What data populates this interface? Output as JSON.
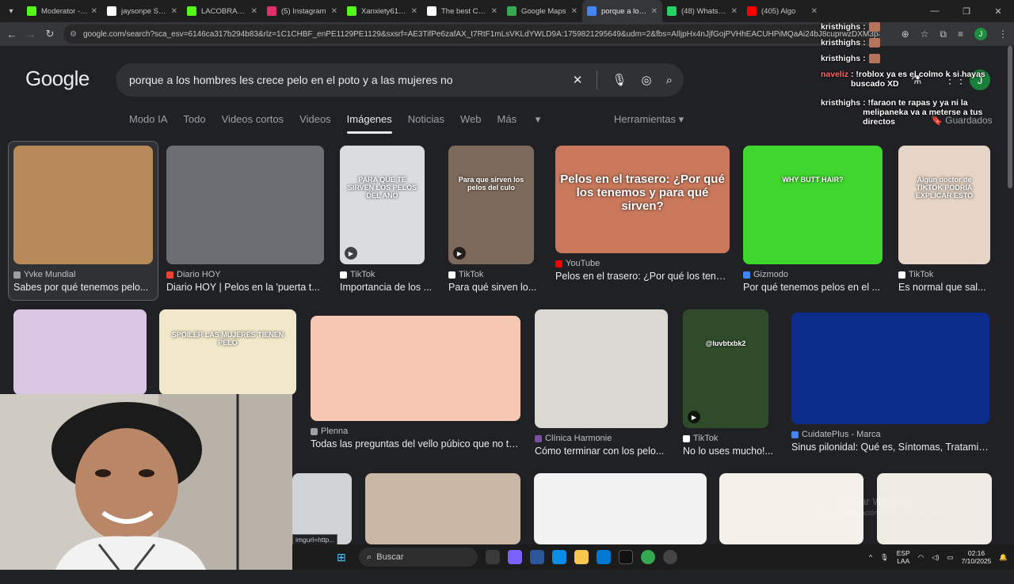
{
  "tabs": [
    {
      "label": "Moderator - Ki",
      "color": "#53fc18"
    },
    {
      "label": "jaysonpe Shop",
      "color": "#ffffff"
    },
    {
      "label": "LACOBRAAA St",
      "color": "#53fc18"
    },
    {
      "label": "(5) Instagram",
      "color": "#e1306c"
    },
    {
      "label": "Xanxiety616 St",
      "color": "#53fc18"
    },
    {
      "label": "The best Chatl",
      "color": "#ffffff"
    },
    {
      "label": "Google Maps",
      "color": "#34a853"
    },
    {
      "label": "porque a los h",
      "color": "#4285f4",
      "active": true
    },
    {
      "label": "(48) WhatsApp",
      "color": "#25d366"
    },
    {
      "label": "(405) Algo",
      "color": "#ff0000"
    }
  ],
  "address": {
    "url": "google.com/search?sca_esv=6146ca317b294b83&rlz=1C1CHBF_enPE1129PE1129&sxsrf=AE3TifPe6zafAX_t7RtF1mLsVKLdYWLD9A:1759821295649&udm=2&fbs=AIljpHx4nJjfGojPVHhEACUHPiMQaAi24bJ8cuprwzDXM3paF1drghZS4WZkW..."
  },
  "search": {
    "logo": "Google",
    "query": "porque a los hombres les crece pelo en el poto y a las mujeres no"
  },
  "nav": {
    "tabs": [
      "Modo IA",
      "Todo",
      "Videos cortos",
      "Videos",
      "Imágenes",
      "Noticias",
      "Web",
      "Más"
    ],
    "tools": "Herramientas",
    "saved": "Guardados"
  },
  "results_row1": [
    {
      "source": "Yvke Mundial",
      "title": "Sabes por qué tenemos pelo...",
      "src_color": "#9aa0a6",
      "bg": "#b88a5a",
      "video": false
    },
    {
      "source": "Diario HOY",
      "title": "Diario HOY | Pelos en la 'puerta t...",
      "src_color": "#ea4335",
      "bg": "#6b6e72",
      "video": false
    },
    {
      "source": "TikTok",
      "title": "Importancia de los ...",
      "src_color": "#ffffff",
      "bg": "#d9dde0",
      "video": true,
      "overlay": "PARA QUE TE SIRVEN LOS PELOS DEL ANO"
    },
    {
      "source": "TikTok",
      "title": "Para qué sirven lo...",
      "src_color": "#ffffff",
      "bg": "#7d6a5c",
      "video": true,
      "overlay": "Para que sirven los pelos del culo"
    },
    {
      "source": "YouTube",
      "title": "Pelos en el trasero: ¿Por qué los tene...",
      "src_color": "#ff0000",
      "bg": "#c9785b",
      "video": false,
      "overlay": "Pelos en el trasero: ¿Por qué los tenemos y para qué sirven?"
    },
    {
      "source": "Gizmodo",
      "title": "Por qué tenemos pelos en el ...",
      "src_color": "#4285f4",
      "bg": "#3fd62e",
      "video": false,
      "overlay": "WHY BUTT HAIR?"
    },
    {
      "source": "TikTok",
      "title": "Es normal que sal...",
      "src_color": "#ffffff",
      "bg": "#e6d4c6",
      "video": false,
      "overlay": "Algun doctor de TIKTOK PODRIA EXPLICAR ESTO"
    }
  ],
  "results_row2": [
    {
      "source": "",
      "title": "",
      "bg": "#d9c6e4"
    },
    {
      "source": "",
      "title": "",
      "bg": "#f1e7c9",
      "overlay": "SPOILER LAS MUJERES TIENEN PELO"
    },
    {
      "source": "Plenna",
      "title": "Todas las preguntas del vello púbico que no te...",
      "src_color": "#9aa0a6",
      "bg": "#f6c7b2"
    },
    {
      "source": "Clínica Harmonie",
      "title": "Cómo terminar con los pelo...",
      "src_color": "#7b4fa8",
      "bg": "#dcd8d4"
    },
    {
      "source": "TikTok",
      "title": "No lo uses mucho!...",
      "src_color": "#ffffff",
      "bg": "#2f4b2a",
      "video": true,
      "overlay": "@luvbtxbk2"
    },
    {
      "source": "CuidatePlus - Marca",
      "title": "Sinus pilonidal: Qué es, Síntomas, Tratamie...",
      "src_color": "#4285f4",
      "bg": "#0b2c8a"
    }
  ],
  "results_row3": [
    {
      "bg": "#d0d3d6"
    },
    {
      "bg": "#c9b6a5"
    },
    {
      "bg": "#f2f2f2"
    },
    {
      "bg": "#f5f1ea"
    },
    {
      "bg": "#f0ebe3"
    }
  ],
  "chat": [
    {
      "user": "kristhighs",
      "text": ":"
    },
    {
      "user": "kristhighs",
      "text": ":"
    },
    {
      "user": "kristhighs",
      "text": ":"
    },
    {
      "user": "naveliz",
      "text": ": !roblox ya es el colmo k si hayas buscado XD"
    },
    {
      "user": "kristhighs",
      "text": ": !faraon te rapas y ya ni la melipaneka va a meterse a tus directos"
    }
  ],
  "taskbar": {
    "search": "Buscar",
    "lang": "ESP",
    "region": "LAA",
    "time": "02:16",
    "date": "7/10/2025"
  },
  "watermark": {
    "title": "Activar Windows",
    "sub": "Ve a Configuración para activar Windows."
  },
  "status_url": "imgurl=http..."
}
